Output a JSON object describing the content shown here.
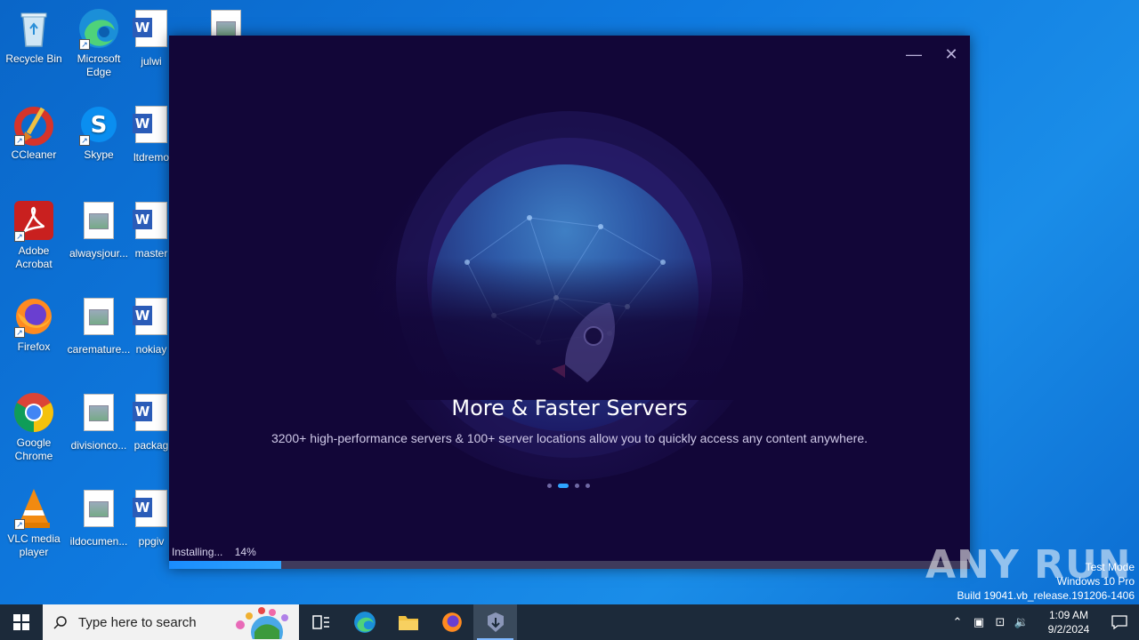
{
  "desktop": {
    "icons": [
      {
        "label": "Recycle Bin"
      },
      {
        "label": "Microsoft Edge"
      },
      {
        "label": "julwi"
      },
      {
        "label": "CCleaner"
      },
      {
        "label": "Skype"
      },
      {
        "label": "ltdremo"
      },
      {
        "label": "Adobe Acrobat"
      },
      {
        "label": "alwaysjour..."
      },
      {
        "label": "master"
      },
      {
        "label": "Firefox"
      },
      {
        "label": "caremature..."
      },
      {
        "label": "nokiay"
      },
      {
        "label": "Google Chrome"
      },
      {
        "label": "divisionco..."
      },
      {
        "label": "packag"
      },
      {
        "label": "VLC media player"
      },
      {
        "label": "ildocumen..."
      },
      {
        "label": "ppgiv"
      }
    ]
  },
  "installer": {
    "minimize_glyph": "—",
    "close_glyph": "✕",
    "title": "More & Faster Servers",
    "subtitle": "3200+ high-performance servers & 100+ server locations allow you to quickly access any content anywhere.",
    "status_label": "Installing...",
    "progress_text": "14%",
    "progress": 0.14,
    "slide_count": 4,
    "active_slide": 2
  },
  "watermark": {
    "brand": "ANY RUN",
    "line1": "Test Mode",
    "line2": "Windows 10 Pro",
    "line3": "Build 19041.vb_release.191206-1406"
  },
  "taskbar": {
    "search_placeholder": "Type here to search",
    "time": "1:09 AM",
    "date": "9/2/2024"
  },
  "colors": {
    "desktop_blue": "#0f7ae0",
    "installer_bg": "#120638",
    "accent": "#2ea4ff"
  }
}
